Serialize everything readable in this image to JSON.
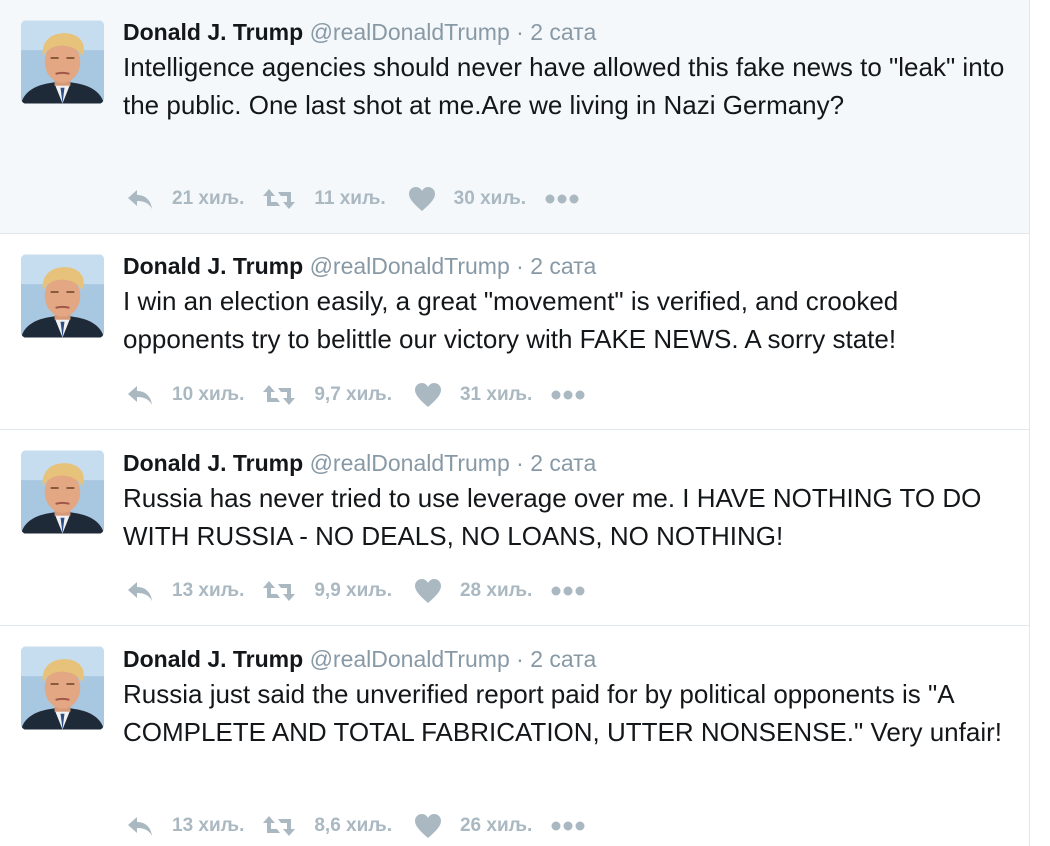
{
  "colors": {
    "name": "#14171a",
    "meta": "#8899a6",
    "action": "#aab8c2",
    "border": "#e1e8ed",
    "highlight_bg": "#f5f8fa"
  },
  "icons": [
    "reply-icon",
    "retweet-icon",
    "like-icon",
    "more-icon"
  ],
  "tweets": [
    {
      "fullname": "Donald J. Trump",
      "username": "@realDonaldTrump",
      "separator": "·",
      "time": "2 сата",
      "text": "Intelligence agencies should never have allowed this fake news to \"leak\" into the public. One last shot at me.Are we living in Nazi Germany?",
      "replies": "21 хиљ.",
      "retweets": "11 хиљ.",
      "likes": "30 хиљ."
    },
    {
      "fullname": "Donald J. Trump",
      "username": "@realDonaldTrump",
      "separator": "·",
      "time": "2 сата",
      "text": "I win an election easily, a great \"movement\" is verified, and crooked opponents try to belittle our victory with FAKE NEWS. A sorry state!",
      "replies": "10 хиљ.",
      "retweets": "9,7 хиљ.",
      "likes": "31 хиљ."
    },
    {
      "fullname": "Donald J. Trump",
      "username": "@realDonaldTrump",
      "separator": "·",
      "time": "2 сата",
      "text": "Russia has never tried to use leverage over me. I HAVE NOTHING TO DO WITH RUSSIA - NO DEALS, NO LOANS, NO NOTHING!",
      "replies": "13 хиљ.",
      "retweets": "9,9 хиљ.",
      "likes": "28 хиљ."
    },
    {
      "fullname": "Donald J. Trump",
      "username": "@realDonaldTrump",
      "separator": "·",
      "time": "2 сата",
      "text": "Russia just said the unverified report paid for by political opponents is \"A COMPLETE AND TOTAL FABRICATION, UTTER NONSENSE.\" Very unfair!",
      "replies": "13 хиљ.",
      "retweets": "8,6 хиљ.",
      "likes": "26 хиљ."
    }
  ]
}
